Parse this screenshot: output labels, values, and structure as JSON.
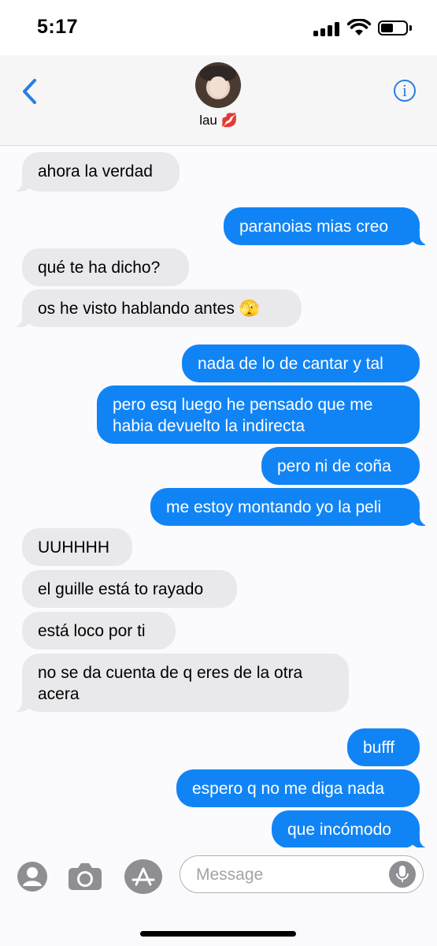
{
  "status_bar": {
    "time": "5:17"
  },
  "header": {
    "contact_name": "lau 💋"
  },
  "messages": [
    {
      "dir": "in",
      "text": "ahora la verdad"
    },
    {
      "dir": "out",
      "text": "paranoias mias creo"
    },
    {
      "dir": "in",
      "text": "qué te ha dicho?"
    },
    {
      "dir": "in",
      "text": "os he visto hablando antes 🫣"
    },
    {
      "dir": "out",
      "text": "nada de lo de cantar y tal"
    },
    {
      "dir": "out",
      "text": "pero esq luego he pensado que me habia devuelto la indirecta"
    },
    {
      "dir": "out",
      "text": "pero ni de coña"
    },
    {
      "dir": "out",
      "text": "me estoy montando yo la peli"
    },
    {
      "dir": "in",
      "text": "UUHHHH"
    },
    {
      "dir": "in",
      "text": "el guille está to rayado"
    },
    {
      "dir": "in",
      "text": "está loco por ti"
    },
    {
      "dir": "in",
      "text": "no se da cuenta de q eres de la otra acera"
    },
    {
      "dir": "out",
      "text": "bufff"
    },
    {
      "dir": "out",
      "text": "espero q no me diga nada"
    },
    {
      "dir": "out",
      "text": "que incómodo"
    }
  ],
  "input": {
    "placeholder": "Message"
  },
  "icons": {
    "back": "chevron-left-icon",
    "info": "info-icon",
    "contact": "contact-icon",
    "camera": "camera-icon",
    "apps": "app-store-icon",
    "mic": "microphone-icon"
  },
  "colors": {
    "accent": "#1184f5",
    "incoming_bubble": "#e9e9eb"
  }
}
